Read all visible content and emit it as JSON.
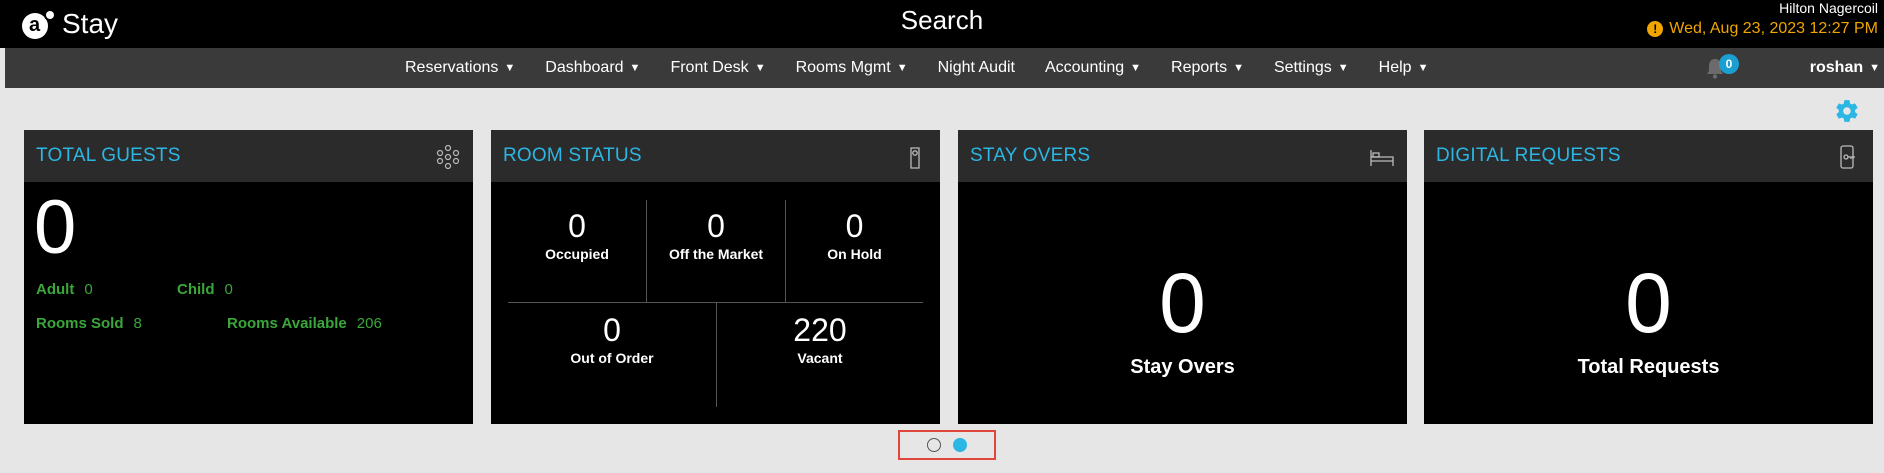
{
  "header": {
    "logo_text": "Stay",
    "title": "Search",
    "hotel_name": "Hilton Nagercoil",
    "datetime": "Wed, Aug 23, 2023 12:27 PM"
  },
  "nav": {
    "items": [
      {
        "label": "Reservations",
        "dropdown": true
      },
      {
        "label": "Dashboard",
        "dropdown": true
      },
      {
        "label": "Front Desk",
        "dropdown": true
      },
      {
        "label": "Rooms Mgmt",
        "dropdown": true
      },
      {
        "label": "Night Audit",
        "dropdown": false
      },
      {
        "label": "Accounting",
        "dropdown": true
      },
      {
        "label": "Reports",
        "dropdown": true
      },
      {
        "label": "Settings",
        "dropdown": true
      },
      {
        "label": "Help",
        "dropdown": true
      }
    ],
    "notifications": "0",
    "user": "roshan"
  },
  "cards": {
    "total_guests": {
      "title": "TOTAL GUESTS",
      "value": "0",
      "adult_label": "Adult",
      "adult_value": "0",
      "child_label": "Child",
      "child_value": "0",
      "rooms_sold_label": "Rooms Sold",
      "rooms_sold_value": "8",
      "rooms_available_label": "Rooms Available",
      "rooms_available_value": "206"
    },
    "room_status": {
      "title": "ROOM STATUS",
      "occupied_value": "0",
      "occupied_label": "Occupied",
      "off_market_value": "0",
      "off_market_label": "Off the Market",
      "on_hold_value": "0",
      "on_hold_label": "On Hold",
      "out_of_order_value": "0",
      "out_of_order_label": "Out of Order",
      "vacant_value": "220",
      "vacant_label": "Vacant"
    },
    "stay_overs": {
      "title": "STAY OVERS",
      "value": "0",
      "label": "Stay Overs"
    },
    "digital_requests": {
      "title": "DIGITAL REQUESTS",
      "value": "0",
      "label": "Total Requests"
    }
  },
  "colors": {
    "accent": "#2bb6e3",
    "green": "#3ba63b",
    "warning": "#f0a500",
    "pager_highlight": "#e0463c"
  }
}
